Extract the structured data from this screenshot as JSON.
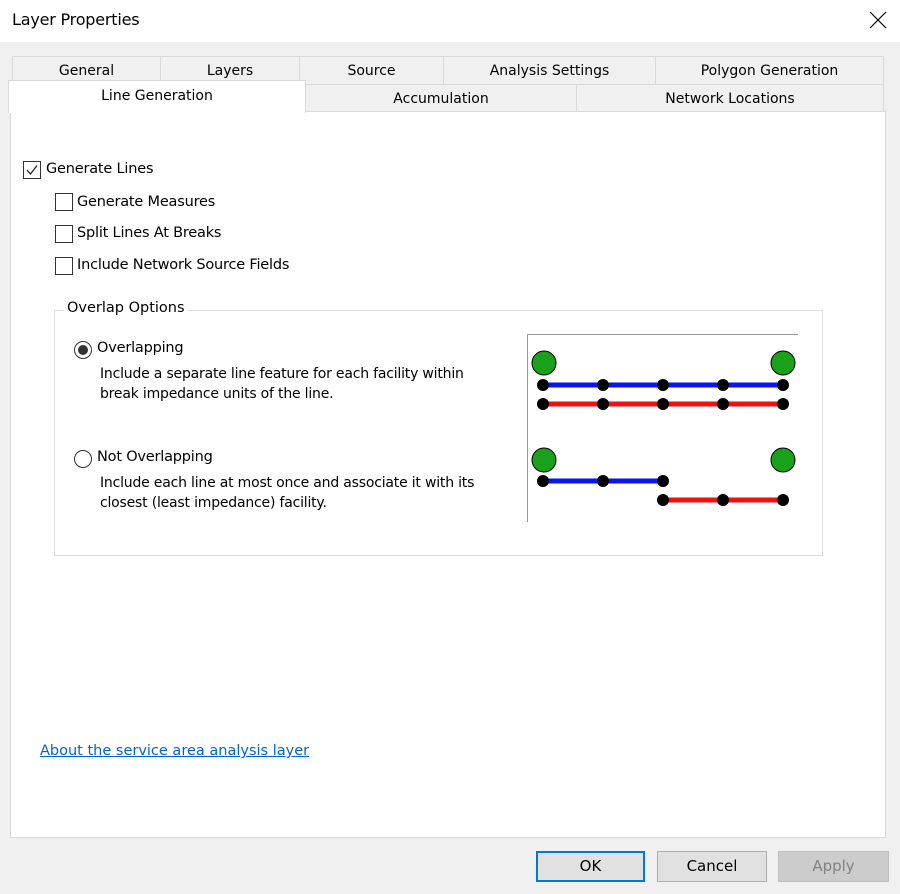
{
  "window": {
    "title": "Layer Properties",
    "close_icon": "close-icon"
  },
  "tabs": {
    "row1": [
      "General",
      "Layers",
      "Source",
      "Analysis Settings",
      "Polygon Generation"
    ],
    "row2": [
      "Line Generation",
      "Accumulation",
      "Network Locations"
    ],
    "active": "Line Generation"
  },
  "options": {
    "generate_lines": {
      "label": "Generate Lines",
      "checked": true
    },
    "generate_measures": {
      "label": "Generate Measures",
      "checked": false
    },
    "split_lines": {
      "label": "Split Lines At Breaks",
      "checked": false
    },
    "include_fields": {
      "label": "Include Network Source Fields",
      "checked": false
    }
  },
  "overlap": {
    "title": "Overlap Options",
    "overlapping": {
      "label": "Overlapping",
      "selected": true,
      "desc1": "Include a separate line feature for each facility within",
      "desc2": "break impedance units of the line."
    },
    "not_overlapping": {
      "label": "Not Overlapping",
      "selected": false,
      "desc1": "Include each line at most once and associate it with its",
      "desc2": "closest (least impedance) facility."
    }
  },
  "link": "About the service area analysis layer",
  "buttons": {
    "ok": "OK",
    "cancel": "Cancel",
    "apply": "Apply"
  },
  "colors": {
    "facility": "#1aa11a",
    "line_a": "#0a14f0",
    "line_b": "#f01010",
    "vertex": "#000000",
    "link": "#0066cc",
    "accent": "#0078d7"
  }
}
